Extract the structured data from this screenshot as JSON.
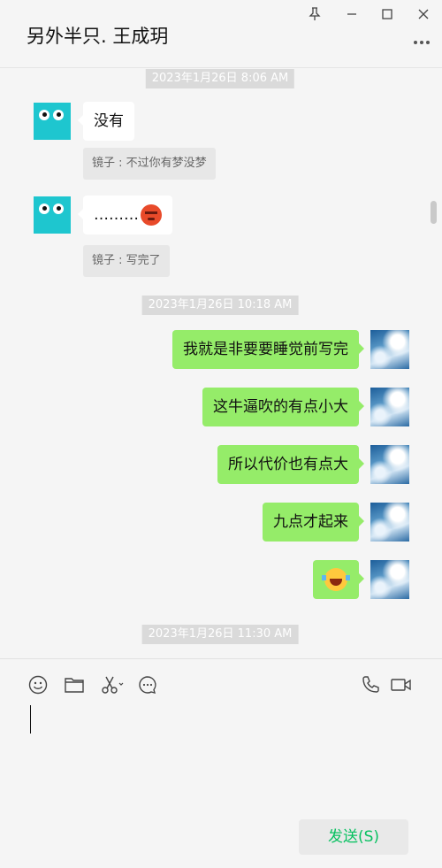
{
  "window": {
    "title": "另外半只. 王成玥",
    "controls": [
      "pin-icon",
      "minimize-icon",
      "maximize-icon",
      "close-icon"
    ],
    "more_icon": "more-icon"
  },
  "messages": [
    {
      "type": "timestamp",
      "text": "2023年1月26日 8:06 AM"
    },
    {
      "type": "incoming",
      "text": "没有",
      "quote": "镜子 : 不过你有梦没梦"
    },
    {
      "type": "incoming",
      "text": "………",
      "emoji": "angry-face",
      "quote": "镜子 : 写完了"
    },
    {
      "type": "timestamp",
      "text": "2023年1月26日 10:18 AM"
    },
    {
      "type": "outgoing",
      "text": "我就是非要要睡觉前写完"
    },
    {
      "type": "outgoing",
      "text": "这牛逼吹的有点小大"
    },
    {
      "type": "outgoing",
      "text": "所以代价也有点大"
    },
    {
      "type": "outgoing",
      "text": "九点才起来"
    },
    {
      "type": "outgoing",
      "text": "",
      "emoji": "laughing-tears-face"
    },
    {
      "type": "timestamp",
      "text": "2023年1月26日 11:30 AM"
    }
  ],
  "compose": {
    "tools": [
      "emoji-icon",
      "folder-icon",
      "scissors-icon",
      "chat-history-icon",
      "phone-icon",
      "video-icon"
    ],
    "input_value": "",
    "send_label": "发送(S)"
  },
  "colors": {
    "background": "#f5f5f5",
    "outgoing_bubble": "#95ec69",
    "incoming_bubble": "#ffffff",
    "timestamp_bg": "#dadada",
    "send_text": "#07c160",
    "avatar_incoming": "#1ec6cf"
  }
}
